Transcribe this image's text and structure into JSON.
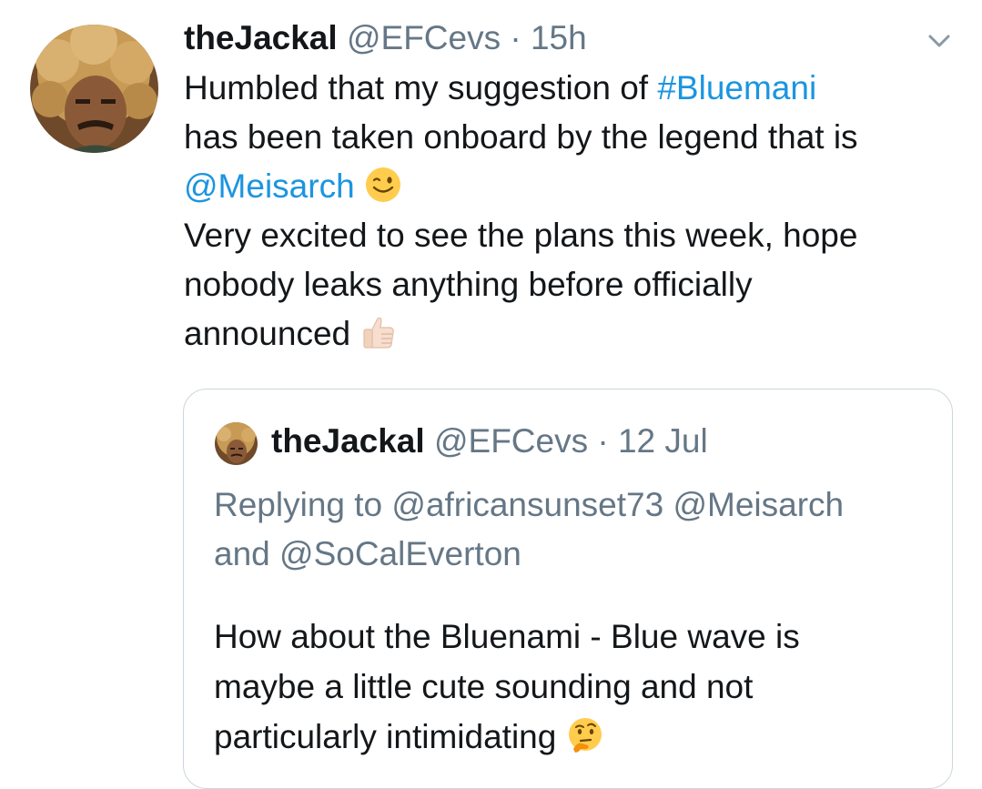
{
  "tweet": {
    "author_name": "theJackal",
    "author_handle": "@EFCevs",
    "separator": "·",
    "time": "15h",
    "text_part1": "Humbled that my suggestion of ",
    "hashtag": "#Bluemani",
    "text_part2": "has been taken onboard by the legend that is",
    "mention": "@Meisarch",
    "emoji_1": "winking-face",
    "text_line4": "Very excited to see the plans this week, hope",
    "text_line5": "nobody leaks anything before officially",
    "text_line6": "announced",
    "emoji_2": "thumbs-up-light-skin"
  },
  "quoted_tweet": {
    "author_name": "theJackal",
    "author_handle": "@EFCevs",
    "separator": "·",
    "time": "12 Jul",
    "replying_prefix": "Replying to ",
    "replying_mention_1": "@africansunset73",
    "replying_mention_2": "@Meisarch",
    "replying_and": "and ",
    "replying_mention_3": "@SoCalEverton",
    "text_line1": "How about the Bluenami - Blue wave is",
    "text_line2": "maybe a little cute sounding and not",
    "text_line3": "particularly intimidating",
    "emoji": "thinking-face"
  },
  "colors": {
    "link": "#1b95e0",
    "secondary_text": "#657786",
    "primary_text": "#14171a",
    "border": "#ccd6dd"
  }
}
